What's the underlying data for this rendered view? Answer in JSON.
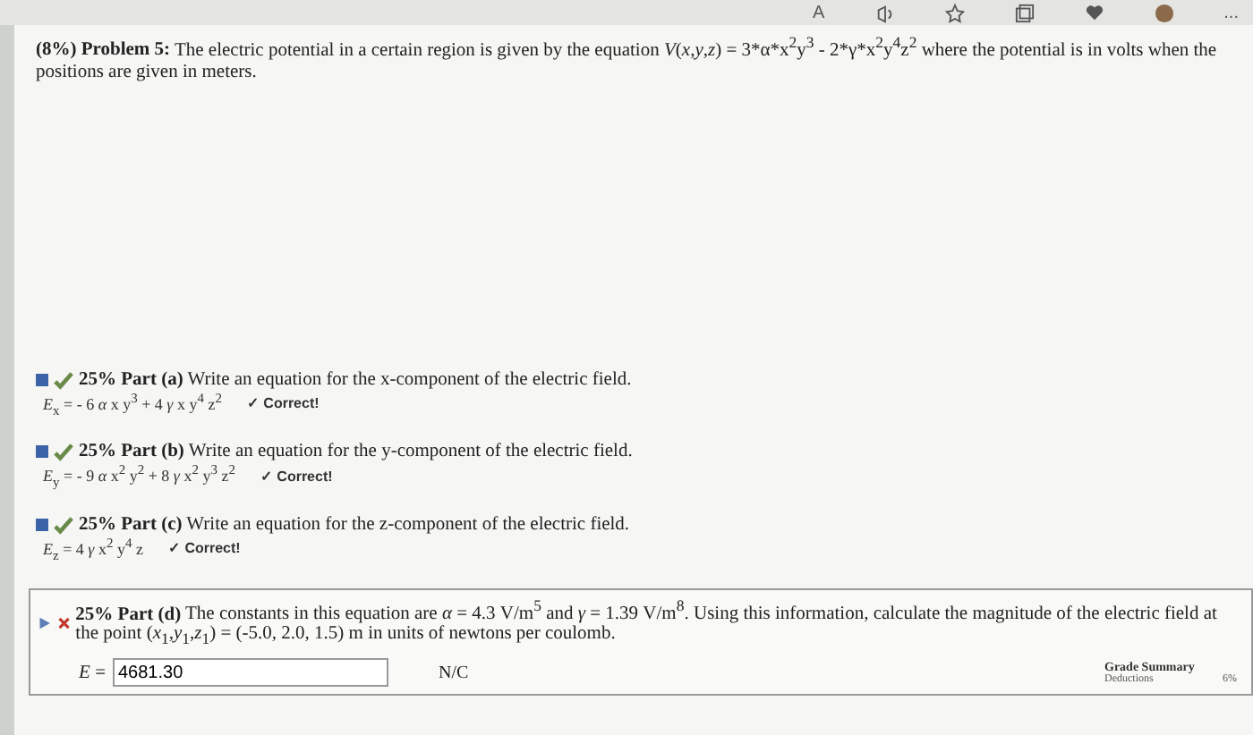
{
  "browser_toolbar": {
    "icons": [
      {
        "kind": "font",
        "label": "A"
      },
      {
        "kind": "speaker"
      },
      {
        "kind": "star"
      },
      {
        "kind": "collections"
      },
      {
        "kind": "heart"
      },
      {
        "kind": "avatar"
      },
      {
        "kind": "more",
        "label": "..."
      }
    ]
  },
  "problem": {
    "heading": "(8%) Problem 5:",
    "text": "The electric potential in a certain region is given by the equation *V*(*x*,*y*,*z*) = 3*α*x$^{2}$y$^{3}$ - 2*γ*x$^{2}$y$^{4}$z$^{2}$ where the potential is in volts when the positions are given in meters."
  },
  "parts": [
    {
      "kind": "answered",
      "correct": true,
      "weight": "25%",
      "label": "Part (a)",
      "text": "Write an equation for the x-component of the electric field.",
      "answer": "*E*$_{x}$ = - 6 *α* x y$^{3}$ + 4 *γ* x y$^{4}$ z$^{2}$",
      "feedback": "✓ Correct!"
    },
    {
      "kind": "answered",
      "correct": true,
      "weight": "25%",
      "label": "Part (b)",
      "text": "Write an equation for the y-component of the electric field.",
      "answer": "*E*$_{y}$ = - 9 *α* x$^{2}$ y$^{2}$ + 8 *γ* x$^{2}$ y$^{3}$ z$^{2}$",
      "feedback": "✓ Correct!"
    },
    {
      "kind": "answered",
      "correct": true,
      "weight": "25%",
      "label": "Part (c)",
      "text": "Write an equation for the z-component of the electric field.",
      "answer": "*E*$_{z}$ = 4 *γ* x$^{2}$ y$^{4}$ z",
      "feedback": "✓ Correct!"
    },
    {
      "kind": "input",
      "correct": false,
      "weight": "25%",
      "label": "Part (d)",
      "text": "The constants in this equation are *α* = 4.3 V/m$^{5}$ and *γ* = 1.39 V/m$^{8}$. Using this information, calculate the magnitude of the electric field at the point (*x*$_{1}$,*y*$_{1}$,*z*$_{1}$) = (-5.0, 2.0, 1.5) m in units of newtons per coulomb.",
      "field_label": "*E* =",
      "value": "4681.30",
      "unit": "N/C"
    }
  ],
  "grade_summary": {
    "title": "Grade Summary",
    "rows": [
      {
        "label": "Deductions",
        "value": "6%"
      }
    ]
  }
}
